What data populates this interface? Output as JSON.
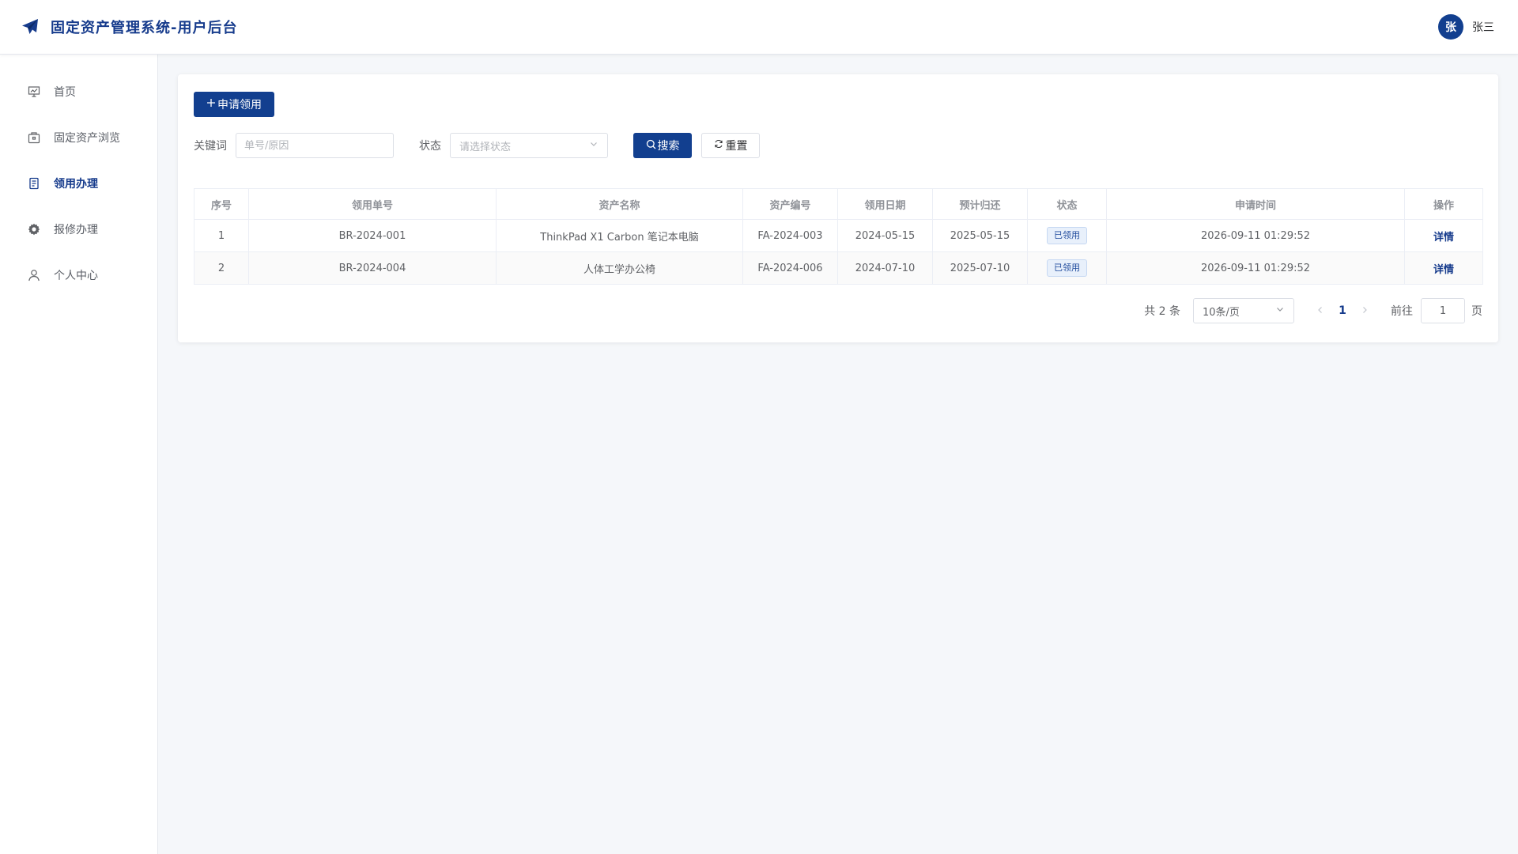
{
  "header": {
    "title": "固定资产管理系统-用户后台",
    "avatar_initial": "张",
    "username": "张三"
  },
  "sidebar": {
    "items": [
      {
        "label": "首页",
        "icon": "presentation-chart-icon",
        "active": false
      },
      {
        "label": "固定资产浏览",
        "icon": "package-box-icon",
        "active": false
      },
      {
        "label": "领用办理",
        "icon": "document-icon",
        "active": true
      },
      {
        "label": "报修办理",
        "icon": "gear-icon",
        "active": false
      },
      {
        "label": "个人中心",
        "icon": "user-icon",
        "active": false
      }
    ]
  },
  "toolbar": {
    "apply_label": "申请领用"
  },
  "filters": {
    "keyword_label": "关键词",
    "keyword_placeholder": "单号/原因",
    "keyword_value": "",
    "status_label": "状态",
    "status_placeholder": "请选择状态",
    "search_label": "搜索",
    "reset_label": "重置"
  },
  "table": {
    "columns": [
      "序号",
      "领用单号",
      "资产名称",
      "资产编号",
      "领用日期",
      "预计归还",
      "状态",
      "申请时间",
      "操作"
    ],
    "rows": [
      {
        "index": "1",
        "order_no": "BR-2024-001",
        "asset_name": "ThinkPad X1 Carbon 笔记本电脑",
        "asset_no": "FA-2024-003",
        "borrow_date": "2024-05-15",
        "return_date": "2025-05-15",
        "status": "已领用",
        "apply_time": "2026-09-11 01:29:52",
        "action": "详情"
      },
      {
        "index": "2",
        "order_no": "BR-2024-004",
        "asset_name": "人体工学办公椅",
        "asset_no": "FA-2024-006",
        "borrow_date": "2024-07-10",
        "return_date": "2025-07-10",
        "status": "已领用",
        "apply_time": "2026-09-11 01:29:52",
        "action": "详情"
      }
    ]
  },
  "pagination": {
    "total_text": "共 2 条",
    "page_size": "10条/页",
    "current_page": "1",
    "goto_label": "前往",
    "goto_value": "1",
    "page_unit": "页"
  },
  "colors": {
    "primary": "#123f8f",
    "active_text": "#163b8c",
    "tag_bg": "#e8f0fb"
  }
}
